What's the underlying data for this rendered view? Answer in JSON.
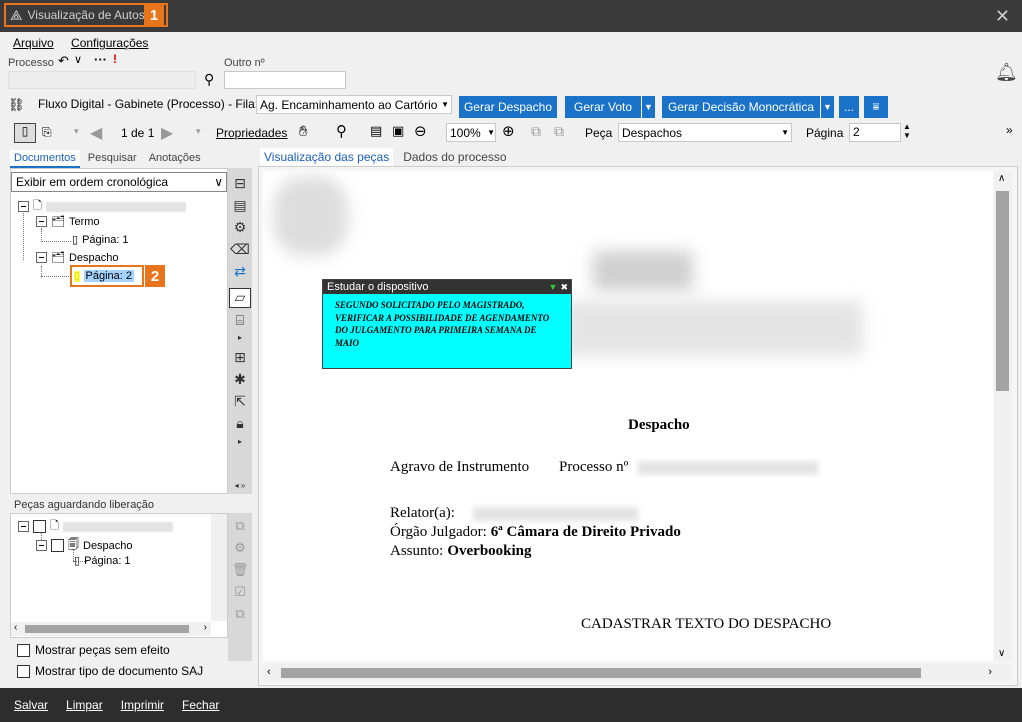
{
  "window": {
    "title": "Visualização de Autos",
    "badge1": "1",
    "badge2": "2"
  },
  "menu": {
    "arquivo": "Arquivo",
    "configuracoes": "Configurações"
  },
  "process_bar": {
    "processo_label": "Processo",
    "outro_label": "Outro nº"
  },
  "workflow": {
    "text": "Fluxo Digital - Gabinete (Processo) - Fila:",
    "queue_value": "Ag. Encaminhamento ao Cartório",
    "btn_despacho": "Gerar Despacho",
    "btn_voto": "Gerar Voto",
    "btn_decisao": "Gerar Decisão Monocrática",
    "btn_more": "..."
  },
  "toolbar": {
    "page_of": "1 de 1",
    "propriedades": "Propriedades",
    "zoom": "100%",
    "peca_label": "Peça",
    "peca_value": "Despachos",
    "pagina_label": "Página",
    "pagina_value": "2"
  },
  "left_tabs": {
    "documentos": "Documentos",
    "pesquisar": "Pesquisar",
    "anotacoes": "Anotações"
  },
  "order_select": "Exibir em ordem cronológica",
  "tree": {
    "termo": "Termo",
    "termo_page": "Página: 1",
    "despacho": "Despacho",
    "despacho_page": "Página: 2"
  },
  "pending": {
    "title": "Peças aguardando liberação",
    "despacho": "Despacho",
    "page": "Página: 1"
  },
  "checks": {
    "sem_efeito": "Mostrar peças sem efeito",
    "tipo_saj": "Mostrar tipo de documento SAJ"
  },
  "view_tabs": {
    "visualizacao": "Visualização das peças",
    "dados": "Dados do processo"
  },
  "note": {
    "title": "Estudar o dispositivo",
    "body": "SEGUNDO SOLICITADO PELO MAGISTRADO, VERIFICAR A POSSIBILIDADE DE AGENDAMENTO DO JULGAMENTO PARA PRIMEIRA SEMANA DE MAIO"
  },
  "document": {
    "heading": "Despacho",
    "agravo": "Agravo de Instrumento",
    "processo": "Processo nº",
    "relator": "Relator(a):",
    "orgao_label": "Órgão Julgador:",
    "orgao_value": "6ª Câmara de Direito Privado",
    "assunto_label": "Assunto:",
    "assunto_value": "Overbooking",
    "cadastrar": "CADASTRAR TEXTO DO DESPACHO"
  },
  "statusbar": {
    "salvar": "Salvar",
    "limpar": "Limpar",
    "imprimir": "Imprimir",
    "fechar": "Fechar"
  }
}
